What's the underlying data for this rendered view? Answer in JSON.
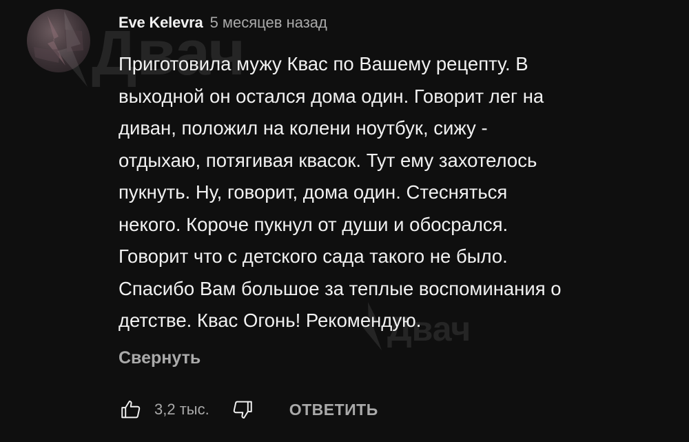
{
  "comment": {
    "author": "Eve Kelevra",
    "time": "5 месяцев назад",
    "text": "Приготовила мужу Квас по Вашему рецепту. В\nвыходной он остался дома один. Говорит лег на\nдиван, положил на колени ноутбук, сижу -\nотдыхаю, потягивая квасок. Тут ему захотелось\nпукнуть. Ну, говорит, дома один. Стесняться\nнекого. Короче пукнул от души и обосрался.\nГоворит что с детского сада такого не было.\nСпасибо Вам большое за теплые воспоминания о\nдетстве. Квас Огонь! Рекомендую.",
    "collapse_label": "Свернуть"
  },
  "actions": {
    "like_icon": "thumb-up-icon",
    "like_count": "3,2 тыс.",
    "dislike_icon": "thumb-down-icon",
    "reply_label": "ОТВЕТИТЬ"
  },
  "watermark": {
    "text": "Двач",
    "icon": "lightning-bolt-icon"
  },
  "colors": {
    "background": "#0f0f0f",
    "primary_text": "#f1f1f1",
    "secondary_text": "#aaaaaa"
  }
}
